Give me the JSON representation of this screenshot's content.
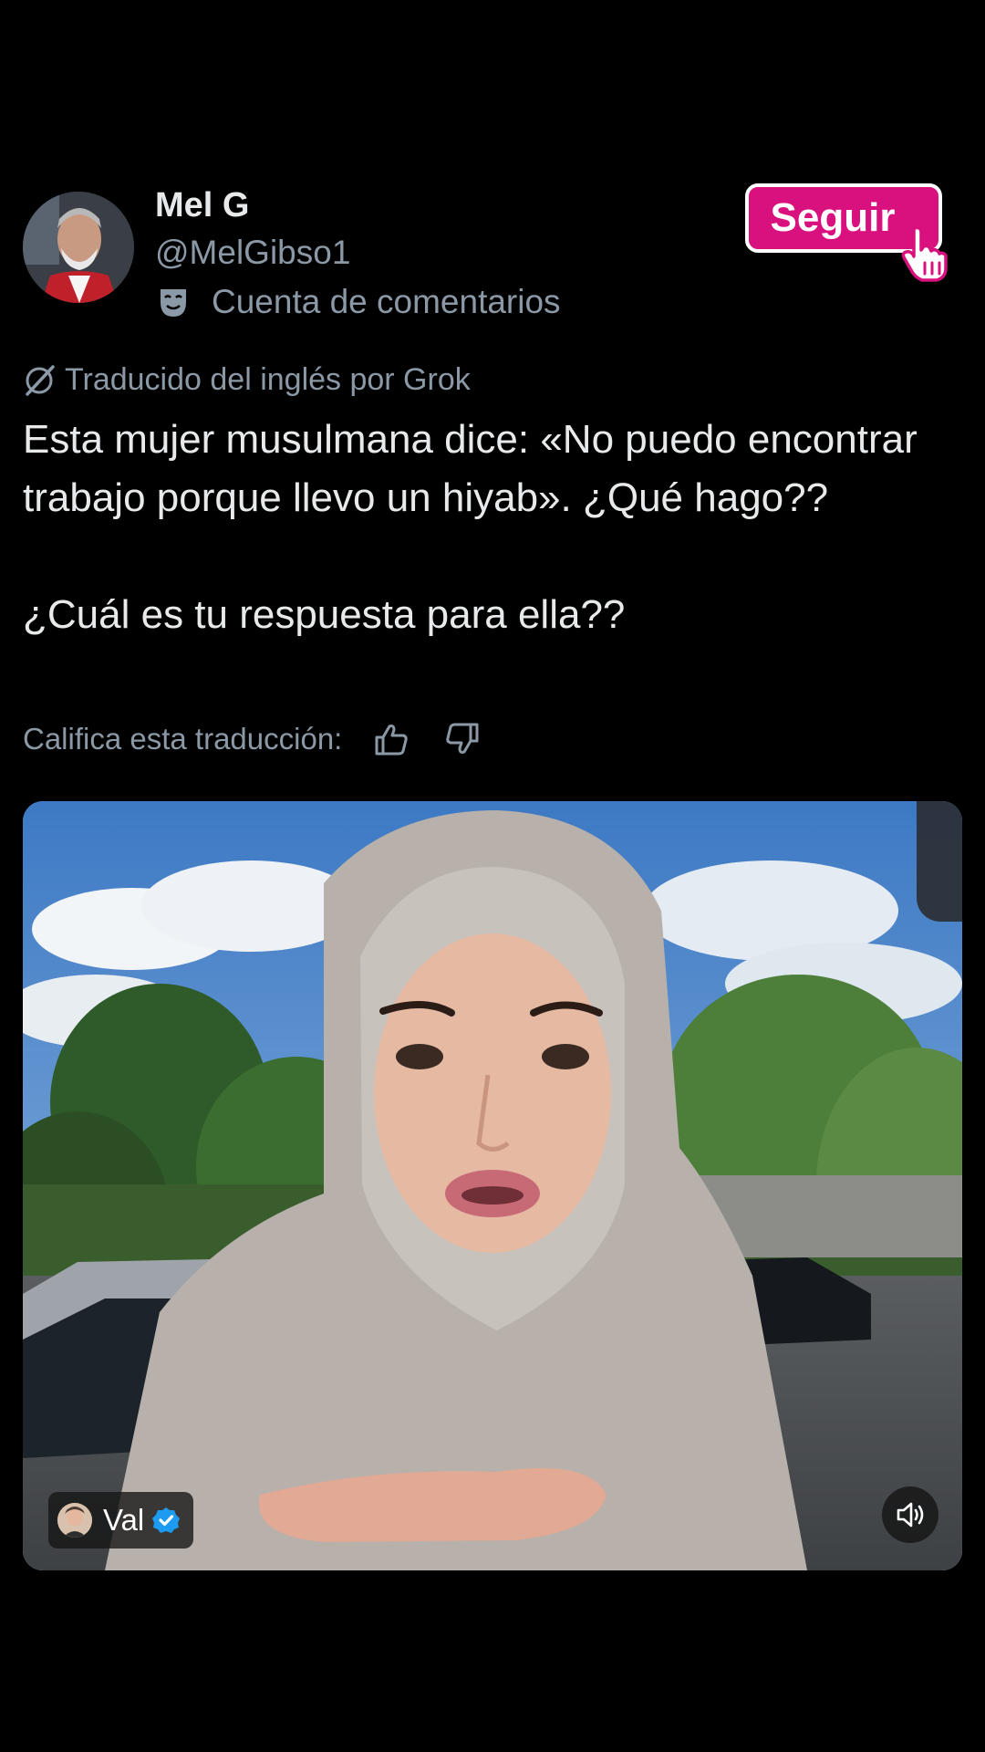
{
  "author": {
    "name": "Mel G",
    "handle": "@MelGibso1",
    "account_label": "Cuenta de comentarios",
    "account_icon": "theater-mask-icon"
  },
  "follow_button": {
    "label": "Seguir",
    "color": "#d8117e"
  },
  "translation": {
    "note": "Traducido del inglés por Grok",
    "rate_label": "Califica esta traducción:"
  },
  "post": {
    "text": "Esta mujer musulmana dice: «No puedo encontrar trabajo porque llevo un hiyab». ¿Qué hago??\n\n¿Cuál es tu respuesta para ella??"
  },
  "media": {
    "type": "video",
    "author_name": "Val",
    "author_verified": true,
    "sound_icon": "volume-icon"
  },
  "colors": {
    "background": "#000000",
    "text_primary": "#e7e9ea",
    "text_secondary": "#8b98a5",
    "verified_blue": "#1d9bf0"
  }
}
